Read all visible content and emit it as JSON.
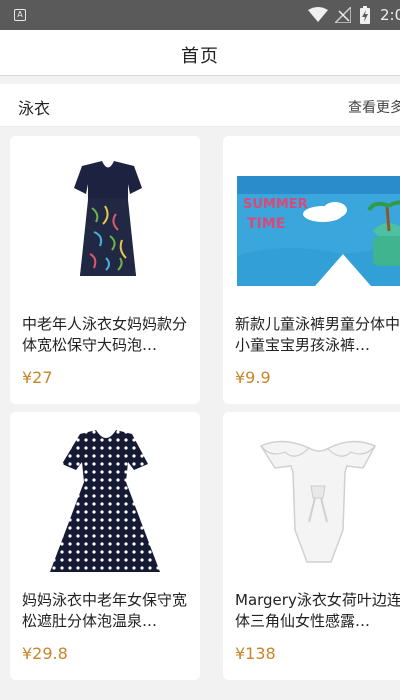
{
  "status_bar": {
    "time": "2:0",
    "icons": [
      "notification-a-icon",
      "wifi-icon",
      "signal-icon",
      "battery-charging-icon"
    ]
  },
  "header": {
    "title": "首页"
  },
  "section": {
    "title": "泳衣",
    "more_label": "查看更多"
  },
  "products": [
    {
      "name": "中老年人泳衣女妈妈款分体宽松保守大码泡…",
      "price": "¥27",
      "image": "navy-floral-tankini-swimsuit"
    },
    {
      "name": "新款儿童泳裤男童分体中小童宝宝男孩泳裤…",
      "price": "¥9.9",
      "image": "kids-blue-swim-trunks-summer-time"
    },
    {
      "name": "妈妈泳衣中老年女保守宽松遮肚分体泡温泉…",
      "price": "¥29.8",
      "image": "navy-polka-dot-swim-dress"
    },
    {
      "name": "Margery泳衣女荷叶边连体三角仙女性感露…",
      "price": "¥138",
      "image": "white-ruffle-one-piece-swimsuit"
    }
  ],
  "colors": {
    "status_bar": "#5a5a5a",
    "background": "#f2f2f2",
    "price": "#c8862a"
  }
}
